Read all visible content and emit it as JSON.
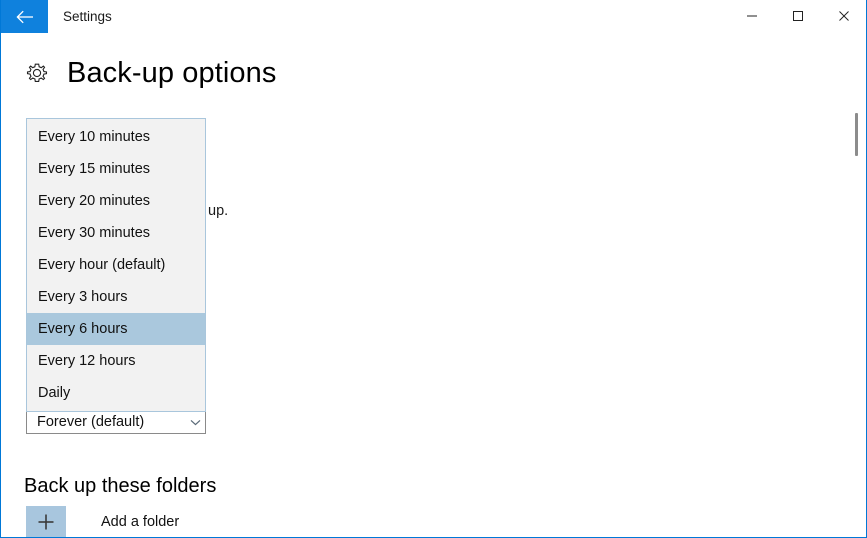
{
  "window": {
    "titlebar": {
      "title": "Settings",
      "back_icon": "arrow-left-icon",
      "minimize_label": "–",
      "maximize_label": "□",
      "close_label": "×",
      "accent_color": "#0f81dd"
    }
  },
  "page": {
    "icon": "gear-icon",
    "title": "Back-up options"
  },
  "background_content": {
    "occluded_description": "up.",
    "keep_combo": {
      "value": "Forever (default)",
      "chevron_icon": "chevron-down-icon"
    }
  },
  "backup_frequency_dropdown": {
    "selected": "Every 6 hours",
    "highlight_color": "#aac8dd",
    "border_color": "#a9c6dc",
    "background_color": "#f2f2f2",
    "options": [
      "Every 10 minutes",
      "Every 15 minutes",
      "Every 20 minutes",
      "Every 30 minutes",
      "Every hour (default)",
      "Every 3 hours",
      "Every 6 hours",
      "Every 12 hours",
      "Daily"
    ]
  },
  "folders_section": {
    "heading": "Back up these folders",
    "add_folder": {
      "label": "Add a folder",
      "icon": "plus-icon",
      "button_color": "#a8c6de"
    }
  },
  "scrollbar": {
    "thumb_color": "#8c8c8c"
  }
}
